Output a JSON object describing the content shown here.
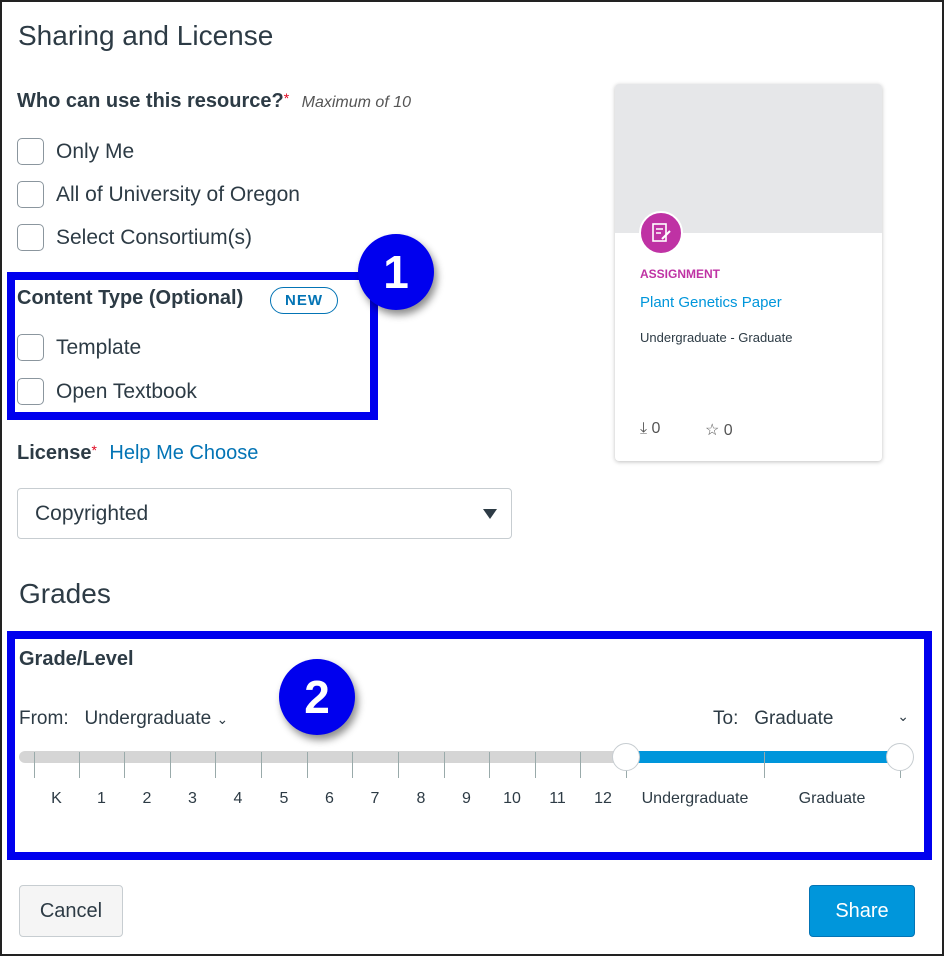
{
  "title": "Sharing and License",
  "who": {
    "label": "Who can use this resource?",
    "required": "*",
    "hint": "Maximum of 10",
    "options": [
      "Only Me",
      "All of University of Oregon",
      "Select Consortium(s)"
    ]
  },
  "content_type": {
    "label": "Content Type (Optional)",
    "badge": "NEW",
    "options": [
      "Template",
      "Open Textbook"
    ]
  },
  "license": {
    "label": "License",
    "required": "*",
    "help_link": "Help Me Choose",
    "value": "Copyrighted"
  },
  "grades": {
    "title": "Grades",
    "label": "Grade/Level",
    "from_label": "From:",
    "from_value": "Undergraduate",
    "to_label": "To:",
    "to_value": "Graduate",
    "ticks": [
      "K",
      "1",
      "2",
      "3",
      "4",
      "5",
      "6",
      "7",
      "8",
      "9",
      "10",
      "11",
      "12",
      "Undergraduate",
      "Graduate"
    ],
    "selected_range": [
      "Undergraduate",
      "Graduate"
    ],
    "accent": "#0096db"
  },
  "card": {
    "type": "ASSIGNMENT",
    "title": "Plant Genetics Paper",
    "levels": "Undergraduate - Graduate",
    "downloads": "0",
    "favorites": "0",
    "icon": "assignment-icon",
    "icon_color": "#bf32a4"
  },
  "annotations": [
    "1",
    "2"
  ],
  "buttons": {
    "cancel": "Cancel",
    "share": "Share"
  }
}
